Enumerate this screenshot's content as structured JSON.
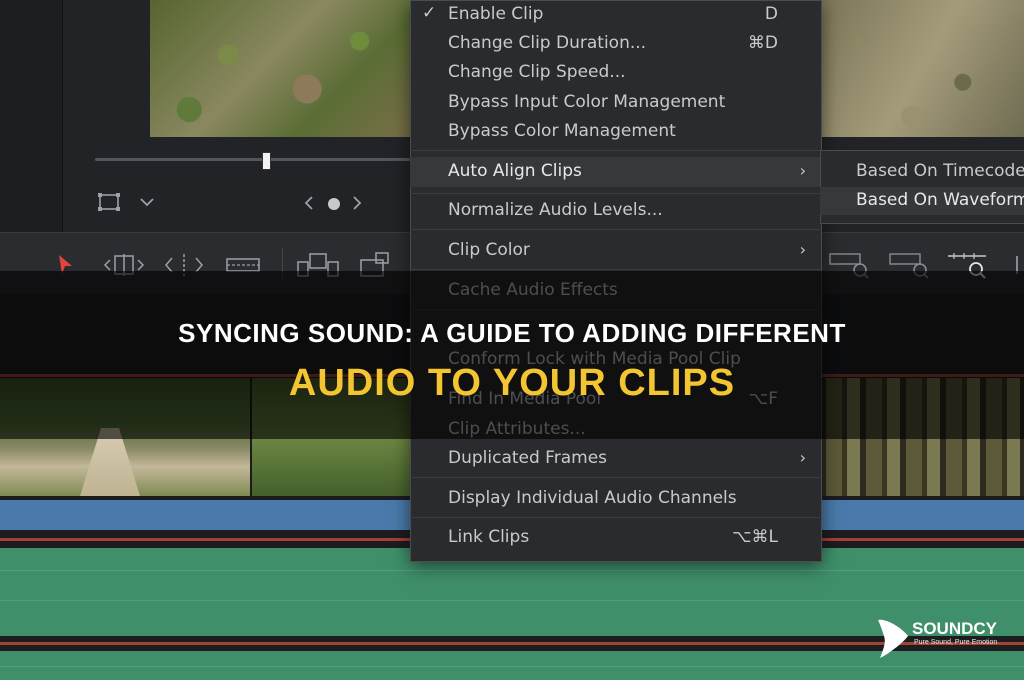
{
  "context_menu": {
    "items": [
      {
        "label": "Enable Clip",
        "shortcut": "D",
        "checked": true
      },
      {
        "label": "Change Clip Duration...",
        "shortcut": "⌘D"
      },
      {
        "label": "Change Clip Speed..."
      },
      {
        "label": "Bypass Input Color Management"
      },
      {
        "label": "Bypass Color Management"
      },
      {
        "label": "Auto Align Clips",
        "submenu": true,
        "highlighted": true
      },
      {
        "label": "Normalize Audio Levels..."
      },
      {
        "label": "Clip Color",
        "submenu": true
      },
      {
        "label": "Cache Audio Effects"
      },
      {
        "label": "Conform Lock with Media Pool Clip"
      },
      {
        "label": "Find In Media Pool",
        "shortcut": "⌥F"
      },
      {
        "label": "Clip Attributes..."
      },
      {
        "label": "Duplicated Frames",
        "submenu": true
      },
      {
        "label": "Display Individual Audio Channels"
      },
      {
        "label": "Link Clips",
        "shortcut": "⌥⌘L"
      }
    ],
    "checkmark": "✓",
    "submenu_arrow": "›"
  },
  "submenu": {
    "items": [
      {
        "label": "Based On Timecode"
      },
      {
        "label": "Based On Waveform",
        "highlighted": true
      }
    ]
  },
  "banner": {
    "line1": "SYNCING SOUND: A GUIDE TO ADDING DIFFERENT",
    "line2": "AUDIO TO YOUR CLIPS"
  },
  "logo": {
    "name": "SOUNDCY",
    "tagline": "Pure Sound, Pure Emotion"
  },
  "viewer": {
    "nav_prev": "‹",
    "nav_next": "›"
  },
  "colors": {
    "menu_bg": "#2a2b2f",
    "title_accent": "#f2c531",
    "audio_blue": "#4a7aab",
    "audio_green": "#3f8f6a",
    "selection_tool": "#e0453a"
  },
  "icons": [
    "viewer-mode-icon",
    "chevron-down-icon",
    "selection-arrow-icon",
    "trim-icon",
    "dynamic-trim-icon",
    "blade-icon",
    "insert-icon",
    "overwrite-icon",
    "zoom-icon"
  ]
}
